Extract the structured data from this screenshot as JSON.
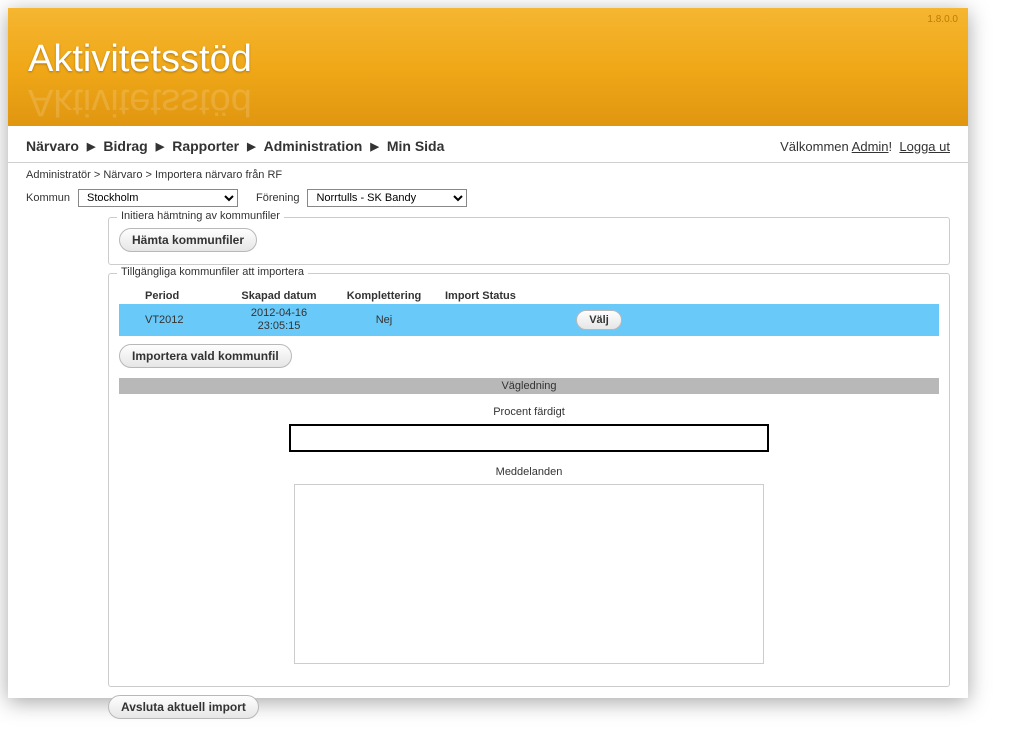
{
  "version": "1.8.0.0",
  "logoText": "Aktivitetsstöd",
  "nav": {
    "items": [
      "Närvaro",
      "Bidrag",
      "Rapporter",
      "Administration",
      "Min Sida"
    ],
    "welcome": "Välkommen ",
    "user": "Admin",
    "exclaim": "!",
    "logout": "Logga ut"
  },
  "breadcrumb": "Administratör > Närvaro > Importera närvaro från RF",
  "filters": {
    "kommunLabel": "Kommun",
    "kommunValue": "Stockholm",
    "foreningLabel": "Förening",
    "foreningValue": "Norrtulls - SK Bandy"
  },
  "box1": {
    "legend": "Initiera hämtning av kommunfiler",
    "button": "Hämta kommunfiler"
  },
  "box2": {
    "legend": "Tillgängliga kommunfiler att importera",
    "headers": {
      "period": "Period",
      "date": "Skapad datum",
      "komp": "Komplettering",
      "status": "Import Status"
    },
    "row": {
      "period": "VT2012",
      "date1": "2012-04-16",
      "date2": "23:05:15",
      "komp": "Nej",
      "status": "",
      "action": "Välj"
    },
    "importBtn": "Importera vald kommunfil",
    "vagledning": "Vägledning",
    "procent": "Procent färdigt",
    "meddelanden": "Meddelanden"
  },
  "bottomBtn": "Avsluta aktuell import"
}
